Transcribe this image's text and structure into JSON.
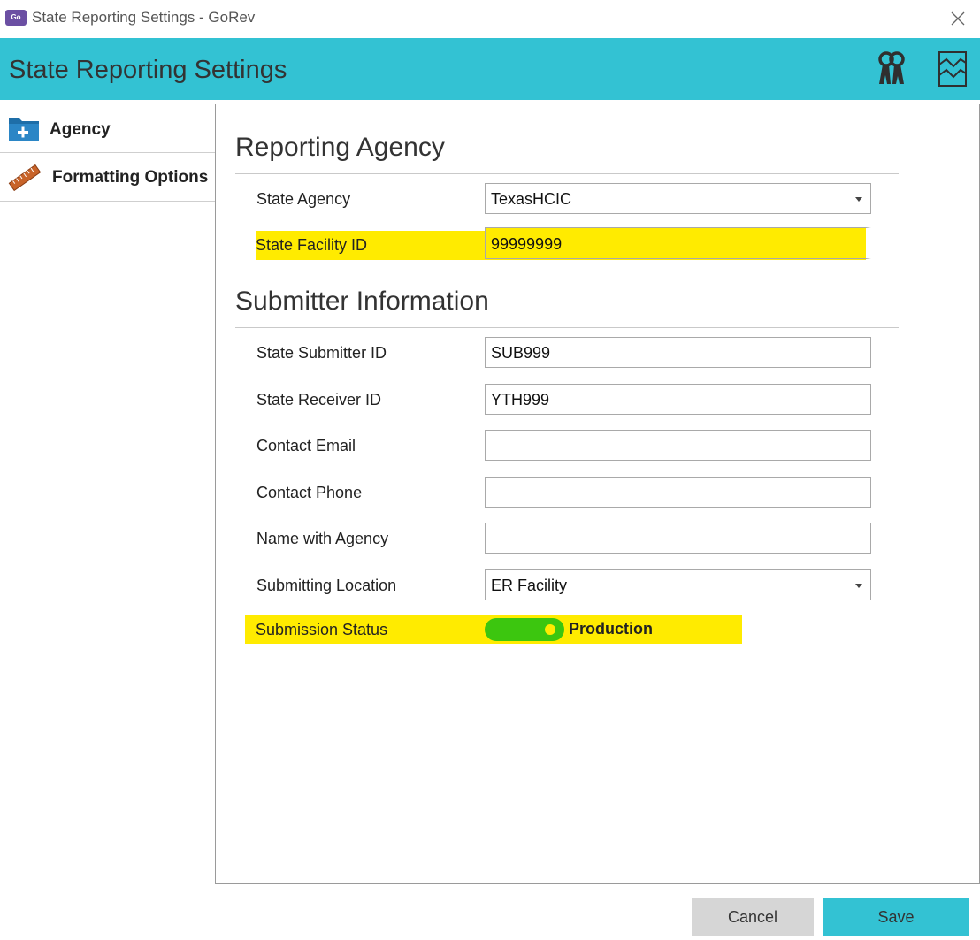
{
  "window": {
    "logo_text": "GoRev",
    "title": "State Reporting Settings - GoRev",
    "close_icon": "close-icon"
  },
  "header": {
    "title": "State Reporting Settings",
    "icons": [
      "keys-icon",
      "chart-icon"
    ],
    "color": "#33c2d3"
  },
  "sidebar": {
    "items": [
      {
        "label": "Agency",
        "icon": "folder-plus-icon"
      },
      {
        "label": "Formatting Options",
        "icon": "ruler-icon"
      }
    ]
  },
  "reporting_agency": {
    "title": "Reporting Agency",
    "state_agency": {
      "label": "State Agency",
      "value": "TexasHCIC"
    },
    "state_facility_id": {
      "label": "State Facility ID",
      "value": "99999999"
    }
  },
  "submitter": {
    "title": "Submitter Information",
    "state_submitter_id": {
      "label": "State Submitter ID",
      "value": "SUB999"
    },
    "state_receiver_id": {
      "label": "State Receiver ID",
      "value": "YTH999"
    },
    "contact_email": {
      "label": "Contact Email",
      "value": ""
    },
    "contact_phone": {
      "label": "Contact Phone",
      "value": ""
    },
    "name_with_agency": {
      "label": "Name with Agency",
      "value": ""
    },
    "submitting_location": {
      "label": "Submitting Location",
      "value": "ER Facility"
    },
    "submission_status": {
      "label": "Submission Status",
      "value": "Production",
      "on": true,
      "toggle_color": "#3cc60f"
    }
  },
  "highlight_color": "#ffeb00",
  "footer": {
    "cancel_label": "Cancel",
    "save_label": "Save"
  }
}
